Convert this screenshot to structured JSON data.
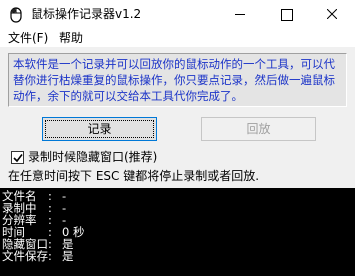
{
  "window": {
    "title": "鼠标操作记录器v1.2",
    "app_icon": "mouse-app-icon"
  },
  "menu": {
    "file": "文件(F)",
    "help": "帮助"
  },
  "description": "本软件是一个记录并可以回放你的鼠标动作的一个工具，可以代替你进行枯燥重复的鼠标操作，你只要点记录，然后做一遍鼠标动作，余下的就可以交给本工具代你完成了。",
  "buttons": {
    "record": "记录",
    "replay": "回放"
  },
  "options": {
    "hide_window_label": "录制时候隐藏窗口(推荐)",
    "hide_window_checked": true
  },
  "hint": "在任意时间按下 ESC 键都将停止录制或者回放.",
  "status": [
    {
      "key": "文件名",
      "value": "-"
    },
    {
      "key": "录制中",
      "value": "-"
    },
    {
      "key": "分辨率",
      "value": "-"
    },
    {
      "key": "时间",
      "value": "0 秒"
    },
    {
      "key": "隐藏窗口",
      "value": "是"
    },
    {
      "key": "文件保存",
      "value": "是"
    }
  ],
  "colors": {
    "description_text": "#1c34c8",
    "console_bg": "#000000",
    "console_text": "#ffffff"
  }
}
